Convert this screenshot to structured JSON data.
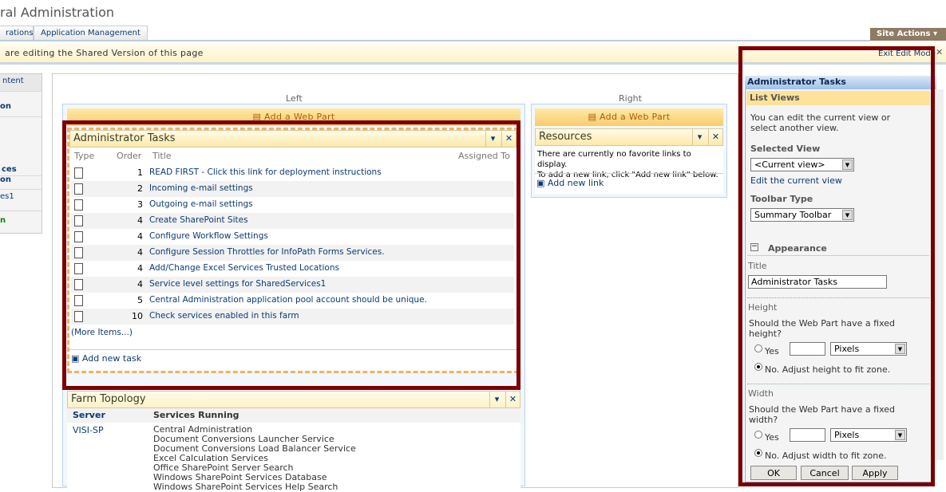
{
  "header": {
    "title": "ral Administration",
    "tabs": [
      "rations",
      "Application Management"
    ],
    "site_actions": "Site Actions ▾"
  },
  "editbar": {
    "message": "are editing the Shared Version of this page",
    "exit": "Exit Edit Mode",
    "close": "✕"
  },
  "leftnav": [
    "ntent",
    "on",
    "ces",
    "on",
    "es1",
    "n"
  ],
  "zones": {
    "left": "Left",
    "right": "Right",
    "add_web_part": "Add a Web Part"
  },
  "admin_tasks": {
    "title": "Administrator Tasks",
    "columns": [
      "Type",
      "Order",
      "Title",
      "Assigned To"
    ],
    "rows": [
      {
        "order": "1",
        "title": "READ FIRST - Click this link for deployment instructions"
      },
      {
        "order": "2",
        "title": "Incoming e-mail settings"
      },
      {
        "order": "3",
        "title": "Outgoing e-mail settings"
      },
      {
        "order": "4",
        "title": "Create SharePoint Sites"
      },
      {
        "order": "4",
        "title": "Configure Workflow Settings"
      },
      {
        "order": "4",
        "title": "Configure Session Throttles for InfoPath Forms Services."
      },
      {
        "order": "4",
        "title": "Add/Change Excel Services Trusted Locations"
      },
      {
        "order": "4",
        "title": "Service level settings for SharedServices1"
      },
      {
        "order": "5",
        "title": "Central Administration application pool account should be unique."
      },
      {
        "order": "10",
        "title": "Check services enabled in this farm"
      }
    ],
    "more": "(More Items...)",
    "add": "Add new task"
  },
  "farm": {
    "title": "Farm Topology",
    "col_server": "Server",
    "col_services": "Services Running",
    "server": "VISI-SP",
    "services": [
      "Central Administration",
      "Document Conversions Launcher Service",
      "Document Conversions Load Balancer Service",
      "Excel Calculation Services",
      "Office SharePoint Server Search",
      "Windows SharePoint Services Database",
      "Windows SharePoint Services Help Search"
    ]
  },
  "resources": {
    "title": "Resources",
    "line1": "There are currently no favorite links to display.",
    "line2": "To add a new link, click \"Add new link\" below.",
    "add": "Add new link"
  },
  "toolpane": {
    "title": "Administrator Tasks",
    "section": "List Views",
    "desc1": "You can edit the current view or",
    "desc2": "select another view.",
    "selected_view_label": "Selected View",
    "selected_view": "<Current view>",
    "edit_view": "Edit the current view",
    "toolbar_label": "Toolbar Type",
    "toolbar": "Summary Toolbar",
    "appearance": "Appearance",
    "title_label": "Title",
    "title_value": "Administrator Tasks",
    "height_label": "Height",
    "height_q1": "Should the Web Part have a fixed",
    "height_q2": "height?",
    "yes": "Yes",
    "pixels": "Pixels",
    "height_no": "No. Adjust height to fit zone.",
    "width_label": "Width",
    "width_q1": "Should the Web Part have a fixed",
    "width_q2": "width?",
    "width_no": "No. Adjust width to fit zone.",
    "ok": "OK",
    "cancel": "Cancel",
    "apply": "Apply"
  }
}
